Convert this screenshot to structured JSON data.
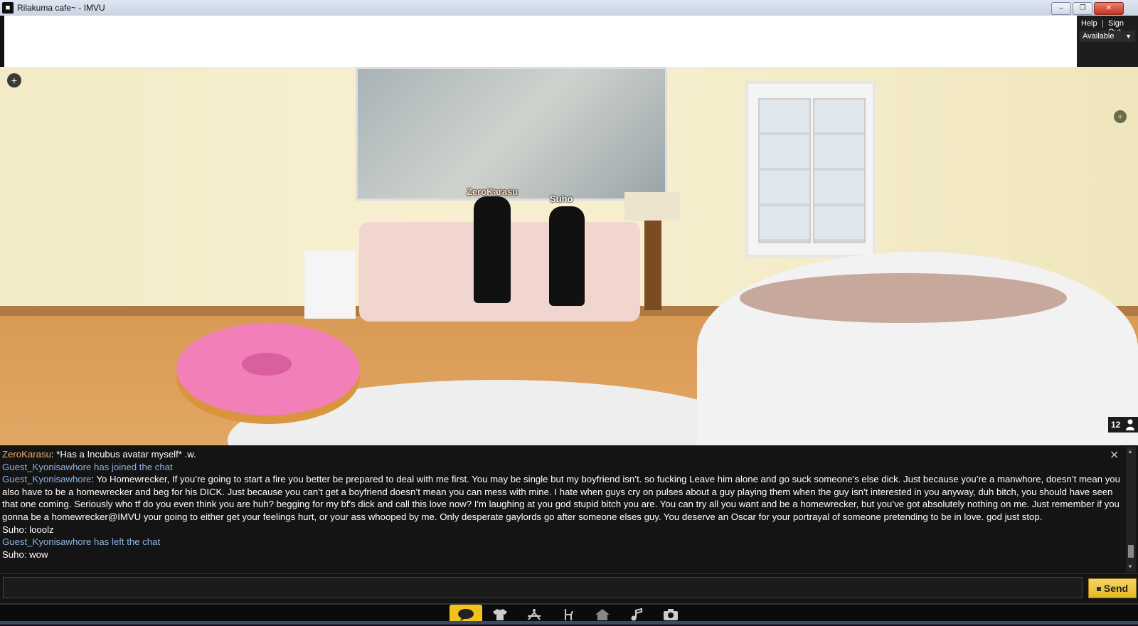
{
  "window": {
    "title": "Rilakuma cafe~ - IMVU",
    "icon": "imvu-logo-icon",
    "buttons": [
      "minimize",
      "restore",
      "close"
    ]
  },
  "account": {
    "help_label": "Help",
    "separator": "|",
    "signout_label": "Sign Out",
    "status": "Available"
  },
  "scene": {
    "avatars": [
      {
        "name": "ZeroKarasu"
      },
      {
        "name": "Suho"
      }
    ],
    "people_count": "12"
  },
  "chat": {
    "messages": [
      {
        "sender": "ZeroKarasu",
        "text": ": *Has a Incubus avatar myself* .w."
      },
      {
        "system": "Guest_Kyonisawhore has joined the chat"
      },
      {
        "sender": "Guest_Kyonisawhore",
        "text": ": Yo Homewrecker, If you’re going to start a fire you better be prepared to deal with me first. You may be single but my boyfriend isn’t. so fucking Leave him alone and go suck someone's else dick. Just because you’re a manwhore, doesn’t mean you also have to be a homewrecker and beg for his DICK. Just because you can’t get a boyfriend doesn’t mean you can mess with mine. I hate when guys cry on pulses about a guy playing them when the guy isn't interested in you anyway, duh bitch, you should have seen that one coming. Seriously who tf do you even think you are huh? begging for my bf's dick and call this love now? I'm laughing at you god stupid bitch you are. You can try all you want and be a homewrecker, but you’ve got absolutely nothing on me. Just remember if you gonna be a homewrecker@IMVU your going to either get your feelings hurt, or your ass whooped by me. Only desperate gaylords go after someone elses guy. You deserve an Oscar for your portrayal of someone pretending to be in love. god just stop."
      },
      {
        "sender": "Suho",
        "text": ": looolz"
      },
      {
        "system": "Guest_Kyonisawhore has left the chat"
      },
      {
        "sender": "Suho",
        "text": ": wow"
      }
    ],
    "input_value": "",
    "send_label": "Send"
  },
  "toolbar": {
    "items": [
      "chat-icon",
      "outfit-icon",
      "pose-icon",
      "furniture-icon",
      "rooms-icon",
      "music-icon",
      "camera-icon"
    ],
    "active": "chat-icon"
  },
  "colors": {
    "accent": "#f3c11c",
    "sender_zero": "#f0a96a",
    "sender_guest": "#8cb3e0",
    "chat_bg": "#141414"
  }
}
